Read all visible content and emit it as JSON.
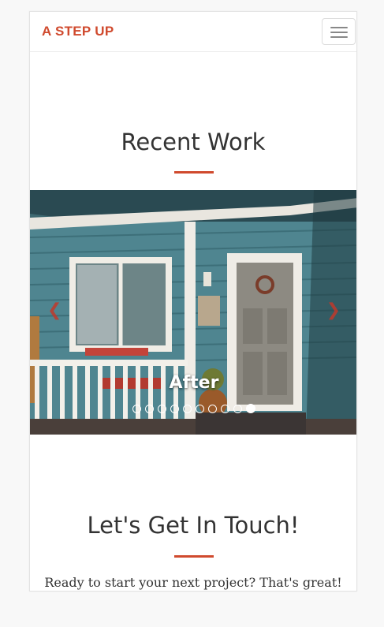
{
  "navbar": {
    "brand": "A STEP UP",
    "toggle_icon": "hamburger-menu-icon"
  },
  "recent_work": {
    "title": "Recent Work",
    "carousel": {
      "caption": "After",
      "prev_icon": "chevron-left-icon",
      "next_icon": "chevron-right-icon",
      "slide_count": 10,
      "active_slide": 10
    }
  },
  "contact": {
    "title": "Let's Get In Touch!",
    "lead": "Ready to start your next project? That's great!"
  },
  "colors": {
    "accent": "#d04a2e",
    "page_background": "#f8f8f8",
    "panel_background": "#ffffff"
  }
}
